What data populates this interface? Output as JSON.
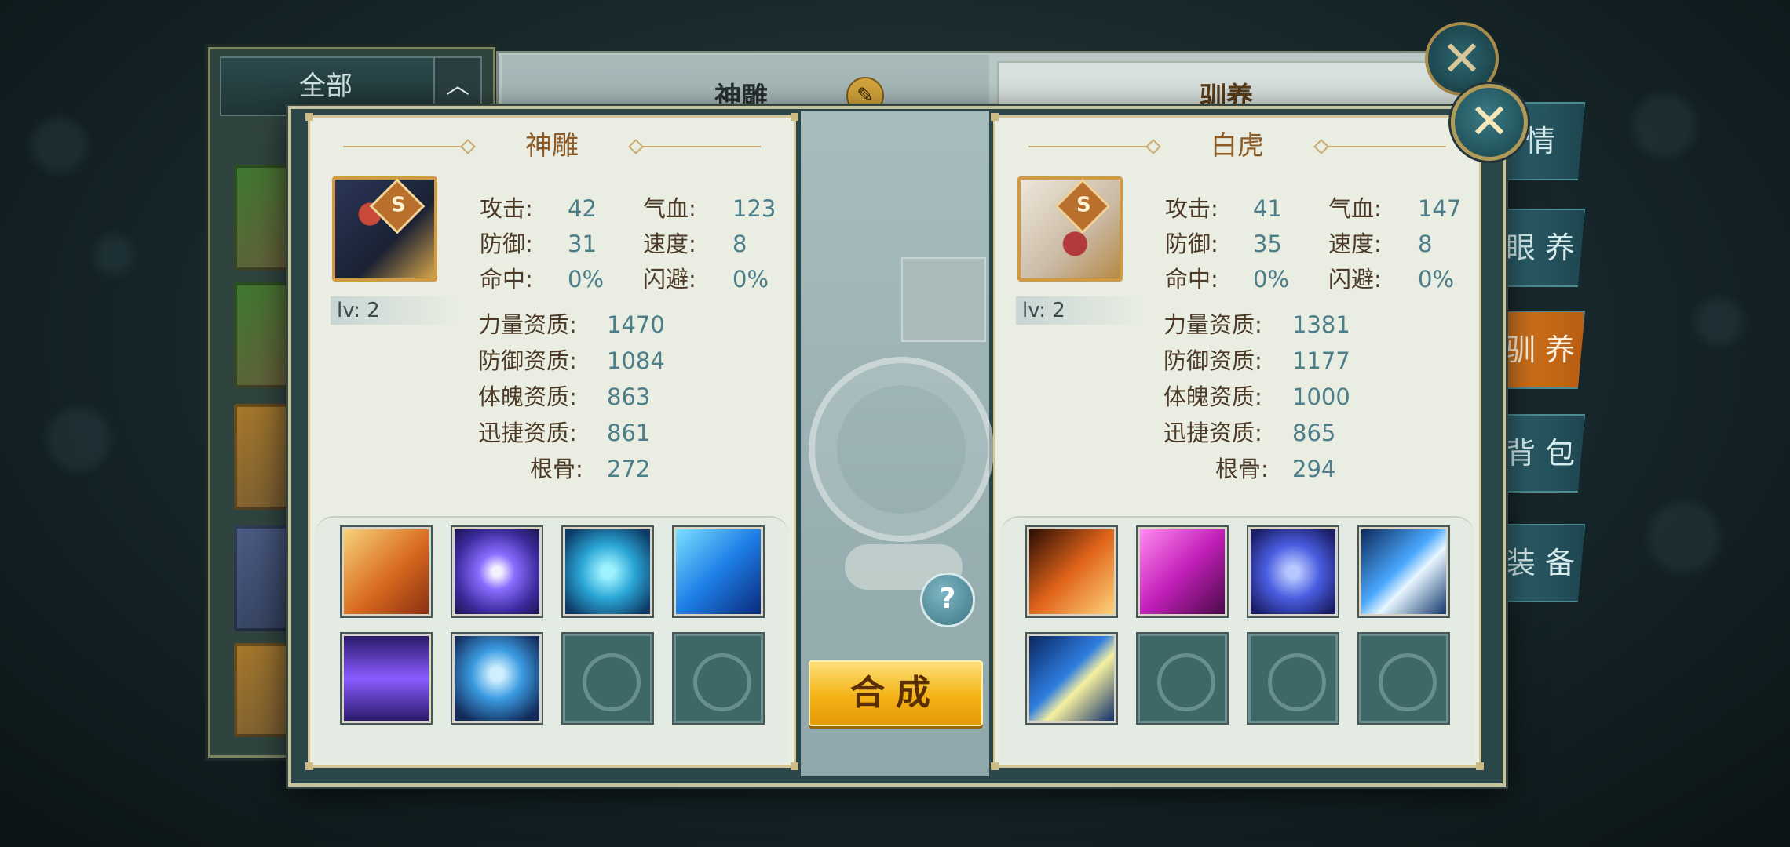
{
  "background": {
    "filter_label": "全部",
    "filter_arrow": "︿",
    "center_title": "神雕",
    "right_title": "驯养",
    "side_tabs": [
      "情",
      "眼 养",
      "驯 养",
      "背 包",
      "装 备"
    ],
    "active_side_tab": 2,
    "close_glyph": "✕",
    "edit_icon": "✎"
  },
  "dialog": {
    "close_glyph": "✕",
    "help_glyph": "?",
    "combine_label": "合成"
  },
  "left_pet": {
    "name": "神雕",
    "grade": "S",
    "level": "lv: 2",
    "stats": [
      {
        "label": "攻击:",
        "value": "42"
      },
      {
        "label": "气血:",
        "value": "123"
      },
      {
        "label": "防御:",
        "value": "31"
      },
      {
        "label": "速度:",
        "value": "8"
      },
      {
        "label": "命中:",
        "value": "0%"
      },
      {
        "label": "闪避:",
        "value": "0%"
      }
    ],
    "aptitudes": [
      {
        "label": "力量资质:",
        "value": "1470"
      },
      {
        "label": "防御资质:",
        "value": "1084"
      },
      {
        "label": "体魄资质:",
        "value": "863"
      },
      {
        "label": "迅捷资质:",
        "value": "861"
      },
      {
        "label": "根骨:",
        "value": "272"
      }
    ],
    "skills": [
      {
        "icon": "golden-beast-skill-icon",
        "bg": "linear-gradient(135deg,#f7d27a,#d86a1e 55%,#8a2f10)"
      },
      {
        "icon": "purple-orb-skill-icon",
        "bg": "radial-gradient(circle,#f4f0ff 8%,#8a6cff 30%,#3a2a9a 70%,#1a1450)"
      },
      {
        "icon": "crossed-blades-skill-icon",
        "bg": "radial-gradient(circle,#9ef2ff 10%,#2aa6d6 45%,#0d3a66 90%)"
      },
      {
        "icon": "blue-wolf-skill-icon",
        "bg": "linear-gradient(135deg,#7ae0ff,#1d7ee6 50%,#0a2a7a)"
      },
      {
        "icon": "purple-vortex-skill-icon",
        "bg": "linear-gradient(180deg,#2a1a6a,#8a5cff 50%,#2a1a6a)"
      },
      {
        "icon": "blue-heart-skill-icon",
        "bg": "radial-gradient(circle at 50% 45%,#cfefff 10%,#3a9ae0 40%,#132b5a 85%)"
      },
      {
        "icon": "empty-slot-icon",
        "empty": true
      },
      {
        "icon": "empty-slot-icon",
        "empty": true
      }
    ]
  },
  "right_pet": {
    "name": "白虎",
    "grade": "S",
    "level": "lv: 2",
    "stats": [
      {
        "label": "攻击:",
        "value": "41"
      },
      {
        "label": "气血:",
        "value": "147"
      },
      {
        "label": "防御:",
        "value": "35"
      },
      {
        "label": "速度:",
        "value": "8"
      },
      {
        "label": "命中:",
        "value": "0%"
      },
      {
        "label": "闪避:",
        "value": "0%"
      }
    ],
    "aptitudes": [
      {
        "label": "力量资质:",
        "value": "1381"
      },
      {
        "label": "防御资质:",
        "value": "1177"
      },
      {
        "label": "体魄资质:",
        "value": "1000"
      },
      {
        "label": "迅捷资质:",
        "value": "865"
      },
      {
        "label": "根骨:",
        "value": "294"
      }
    ],
    "skills": [
      {
        "icon": "fire-phoenix-skill-icon",
        "bg": "linear-gradient(135deg,#2a0d05,#e0641a 50%,#ffd27a)"
      },
      {
        "icon": "magenta-slash-skill-icon",
        "bg": "linear-gradient(135deg,#ff8af0,#c21fb8 50%,#4a0a4a)"
      },
      {
        "icon": "shield-skill-icon",
        "bg": "radial-gradient(circle,#b7c7ff 10%,#4a5de0 45%,#1a1d66 90%)"
      },
      {
        "icon": "lightning-skill-icon",
        "bg": "linear-gradient(135deg,#0d2a5a,#4aa8ff 45%,#e8f6ff 60%,#12396e)"
      },
      {
        "icon": "blue-strike-skill-icon",
        "bg": "linear-gradient(135deg,#0a2660,#2f7de0 45%,#f6f0a0 60%,#0f2f6a)"
      },
      {
        "icon": "empty-slot-icon",
        "empty": true
      },
      {
        "icon": "empty-slot-icon",
        "empty": true
      },
      {
        "icon": "empty-slot-icon",
        "empty": true
      }
    ]
  }
}
